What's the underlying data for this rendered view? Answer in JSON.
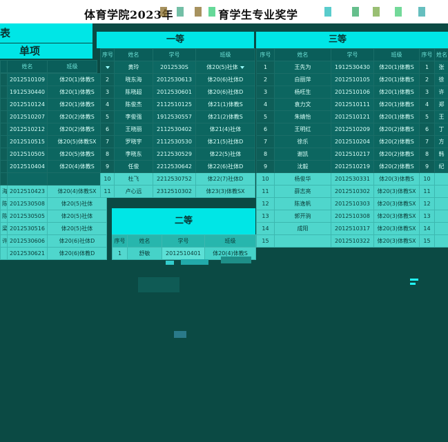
{
  "title": "体育学院2023年",
  "title_tail": "育学生专业奖学",
  "partial_header": "表",
  "single_item_header": "单项",
  "sections": {
    "first": "一等",
    "second": "二等",
    "third": "三等"
  },
  "headers": {
    "seq": "序号",
    "name": "姓名",
    "id": "学号",
    "class": "班级"
  },
  "left_table": {
    "rows": [
      {
        "id": "2012510109",
        "class": "体20(1)体教S"
      },
      {
        "id": "1912530440",
        "class": "体20(1)体教S"
      },
      {
        "id": "2012510124",
        "class": "体20(1)体教S"
      },
      {
        "id": "2012510207",
        "class": "体20(2)体教S"
      },
      {
        "id": "2012510212",
        "class": "体20(2)体教S"
      },
      {
        "id": "2012510515",
        "class": "体20(5)体教SX"
      },
      {
        "id": "2012510505",
        "class": "体20(5)体教S"
      },
      {
        "id": "2012510404",
        "class": "体20(4)体教S"
      },
      {
        "id": "",
        "class": ""
      },
      {
        "name": "海",
        "id": "2012510423",
        "class": "体20(4)体教SX"
      },
      {
        "name": "陈晓宇",
        "id": "2012530508",
        "class": "体20(5)社体"
      },
      {
        "name": "陈栋",
        "id": "2012530505",
        "class": "体20(5)社体"
      },
      {
        "name": "梁文展",
        "id": "2012530516",
        "class": "体20(5)社体"
      },
      {
        "name": "许孙",
        "id": "2012530606",
        "class": "体20(6)社体D"
      },
      {
        "name": "",
        "id": "2012530621",
        "class": "体20(6)体教D"
      }
    ]
  },
  "first_prize": {
    "rows": [
      {
        "no": "1",
        "name": "黄玲",
        "id": "2012530S",
        "class": "体20(5)社体"
      },
      {
        "no": "2",
        "name": "晓东海",
        "id": "2012530613",
        "class": "体20(6)社体D"
      },
      {
        "no": "3",
        "name": "陈晓超",
        "id": "2012530601",
        "class": "体20(6)社体D"
      },
      {
        "no": "4",
        "name": "陈俊杰",
        "id": "2112510125",
        "class": "体21(1)体教S"
      },
      {
        "no": "5",
        "name": "李俊强",
        "id": "1912530557",
        "class": "体21(2)体教S"
      },
      {
        "no": "6",
        "name": "王晓丽",
        "id": "2112530402",
        "class": "体21(4)社体"
      },
      {
        "no": "7",
        "name": "罗晓宇",
        "id": "2112530530",
        "class": "体21(5)社体D"
      },
      {
        "no": "8",
        "name": "李晓东",
        "id": "2212530529",
        "class": "体22(5)社体"
      },
      {
        "no": "9",
        "name": "任俊",
        "id": "2212530642",
        "class": "体22(6)社体D"
      },
      {
        "no": "10",
        "name": "杜飞",
        "id": "2212530752",
        "class": "体22(7)社体D"
      },
      {
        "no": "11",
        "name": "卢心远",
        "id": "2312510302",
        "class": "体23(3)体教SX"
      }
    ]
  },
  "second_prize": {
    "rows": [
      {
        "no": "1",
        "name": "舒敏",
        "id": "2012510401",
        "class": "体20(4)体教S"
      }
    ]
  },
  "third_prize": {
    "rows": [
      {
        "no": "1",
        "name": "王先为",
        "id": "1912530430",
        "class": "体20(1)体教S"
      },
      {
        "no": "2",
        "name": "白丽萍",
        "id": "2012510105",
        "class": "体20(1)体教S"
      },
      {
        "no": "3",
        "name": "杨旺生",
        "id": "2012510106",
        "class": "体20(1)体教S"
      },
      {
        "no": "4",
        "name": "袁力文",
        "id": "2012510111",
        "class": "体20(1)体教S"
      },
      {
        "no": "5",
        "name": "朱婧怡",
        "id": "2012510121",
        "class": "体20(1)体教S"
      },
      {
        "no": "6",
        "name": "王明红",
        "id": "2012510209",
        "class": "体20(2)体教S"
      },
      {
        "no": "7",
        "name": "徐乐",
        "id": "2012510204",
        "class": "体20(2)体教S"
      },
      {
        "no": "8",
        "name": "谢凯",
        "id": "2012510217",
        "class": "体20(2)体教S"
      },
      {
        "no": "9",
        "name": "沈毅",
        "id": "2012510219",
        "class": "体20(2)体教S"
      },
      {
        "no": "10",
        "name": "杨俊华",
        "id": "2012530331",
        "class": "体20(3)体教S"
      },
      {
        "no": "11",
        "name": "薛志亮",
        "id": "2012510302",
        "class": "体20(3)体教SX"
      },
      {
        "no": "12",
        "name": "陈逸帆",
        "id": "2012510303",
        "class": "体20(3)体教SX"
      },
      {
        "no": "13",
        "name": "郭开驹",
        "id": "2012510308",
        "class": "体20(3)体教SX"
      },
      {
        "no": "14",
        "name": "成阳",
        "id": "2012510317",
        "class": "体20(3)体教SX"
      },
      {
        "no": "15",
        "name": "",
        "id": "2012510322",
        "class": "体20(3)体教SX"
      }
    ]
  },
  "right_partial": {
    "rows": [
      {
        "no": "1",
        "name": "张"
      },
      {
        "no": "2",
        "name": "徐"
      },
      {
        "no": "3",
        "name": "许"
      },
      {
        "no": "4",
        "name": "郑"
      },
      {
        "no": "5",
        "name": "王"
      },
      {
        "no": "6",
        "name": "丁"
      },
      {
        "no": "7",
        "name": "方"
      },
      {
        "no": "8",
        "name": "韩"
      },
      {
        "no": "9",
        "name": "纪"
      },
      {
        "no": "10",
        "name": ""
      },
      {
        "no": "11",
        "name": ""
      },
      {
        "no": "12",
        "name": ""
      },
      {
        "no": "13",
        "name": ""
      },
      {
        "no": "14",
        "name": ""
      },
      {
        "no": "15",
        "name": ""
      }
    ]
  },
  "colors": {
    "background": "#0b4a44",
    "accent": "#00e6e6",
    "dark_cell": "#0c6660",
    "light_cell": "#46d2c8"
  }
}
